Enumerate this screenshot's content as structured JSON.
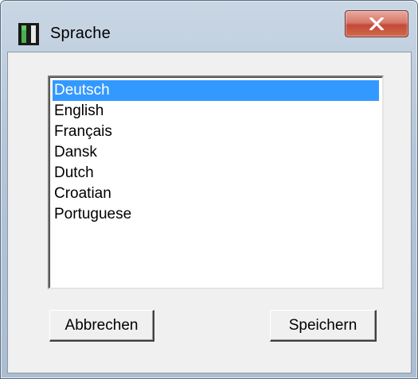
{
  "window": {
    "title": "Sprache",
    "icon": "app-icon",
    "close_icon": "close-icon"
  },
  "language_list": {
    "items": [
      "Deutsch",
      "English",
      "Français",
      "Dansk",
      "Dutch",
      "Croatian",
      "Portuguese"
    ],
    "selected": "Deutsch"
  },
  "buttons": {
    "cancel_label": "Abbrechen",
    "save_label": "Speichern"
  },
  "colors": {
    "selection": "#3399ff",
    "dialog_background": "#f0f0f0",
    "close_button": "#c24a36"
  }
}
